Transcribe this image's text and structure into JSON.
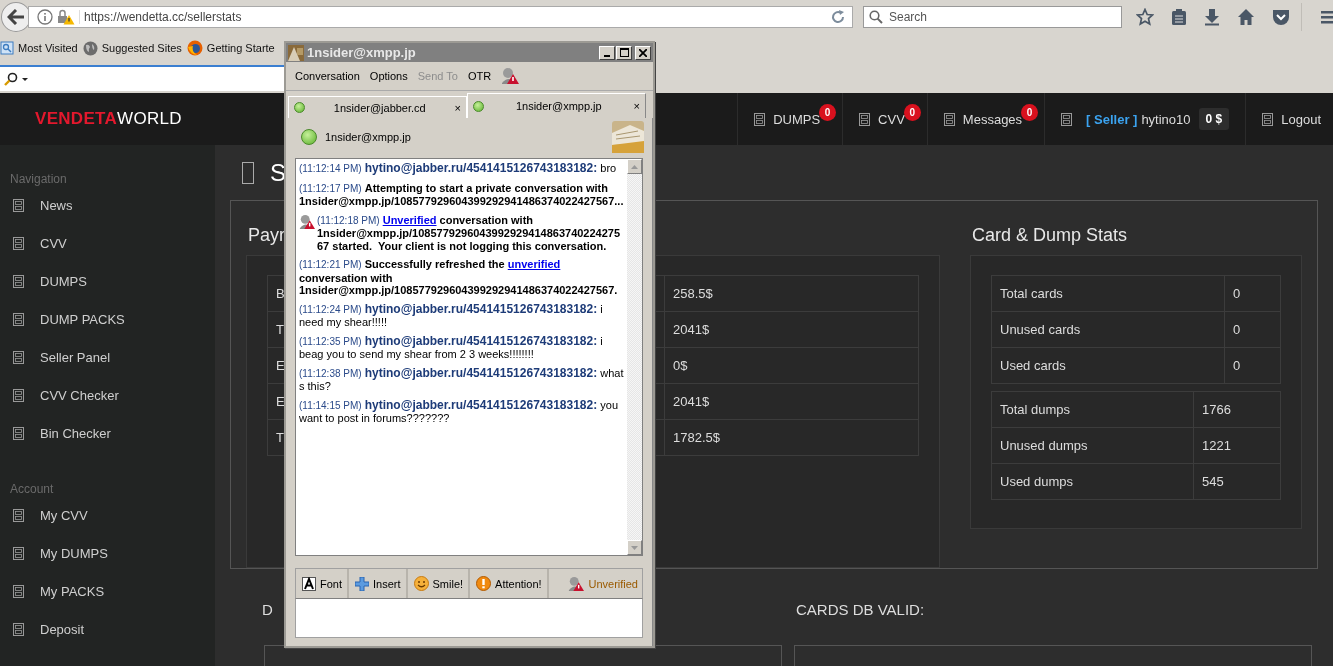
{
  "browser": {
    "url": "https://wendetta.cc/sellerstats",
    "search": {
      "placeholder": "Search"
    },
    "bookmarks": [
      {
        "label": "Most Visited",
        "kind": "folder"
      },
      {
        "label": "Suggested Sites",
        "kind": "globe"
      },
      {
        "label": "Getting Starte",
        "kind": "firefox"
      }
    ]
  },
  "site": {
    "logo": {
      "accent": "VENDETA",
      "text": "WORLD"
    },
    "nav": [
      {
        "label": "DUMPS",
        "badge": "0"
      },
      {
        "label": "CVV",
        "badge": "0"
      },
      {
        "label": "Messages",
        "badge": "0"
      }
    ],
    "user": {
      "role": "[ Seller ]",
      "name": "hytino10",
      "balance": "0 $"
    },
    "logout": "Logout"
  },
  "sidebar": {
    "sections": [
      {
        "heading": "Navigation",
        "items": [
          "News",
          "CVV",
          "DUMPS",
          "DUMP PACKS",
          "Seller Panel",
          "CVV Checker",
          "Bin Checker"
        ]
      },
      {
        "heading": "Account",
        "items": [
          "My CVV",
          "My DUMPS",
          "My PACKS",
          "Deposit"
        ]
      }
    ]
  },
  "page": {
    "title": "S",
    "payments": {
      "heading": "Payr",
      "rows": [
        {
          "label": "B",
          "value": "258.5$"
        },
        {
          "label": "T",
          "value": "2041$"
        },
        {
          "label": "E",
          "value": "0$"
        },
        {
          "label": "E",
          "value": "2041$"
        },
        {
          "label": "T",
          "value": "1782.5$"
        }
      ]
    },
    "stats": {
      "heading": "Card & Dump Stats",
      "groups": [
        [
          {
            "label": "Total cards",
            "value": "0"
          },
          {
            "label": "Unused cards",
            "value": "0"
          },
          {
            "label": "Used cards",
            "value": "0"
          }
        ],
        [
          {
            "label": "Total dumps",
            "value": "1766"
          },
          {
            "label": "Unused dumps",
            "value": "1221"
          },
          {
            "label": "Used dumps",
            "value": "545"
          }
        ]
      ]
    },
    "bottom": [
      "D",
      "CARDS DB VALID:"
    ]
  },
  "chat_window": {
    "title": "1nsider@xmpp.jp",
    "menu": [
      {
        "label": "Conversation",
        "disabled": false
      },
      {
        "label": "Options",
        "disabled": false
      },
      {
        "label": "Send To",
        "disabled": true
      },
      {
        "label": "OTR",
        "disabled": false
      }
    ],
    "tabs": [
      {
        "label": "1nsider@jabber.cd",
        "close": "×",
        "selected": false
      },
      {
        "label": "1nsider@xmpp.jp",
        "close": "×",
        "selected": true
      }
    ],
    "contact": "1nsider@xmpp.jp",
    "messages": [
      {
        "kind": "incoming",
        "time": "(11:12:14 PM)",
        "sender": "hytino@jabber.ru/4541415126743183182:",
        "text": "bro"
      },
      {
        "kind": "system",
        "warning": false,
        "time": "(11:12:17 PM)",
        "parts": [
          {
            "text": "Attempting to start a private conversation with 1nsider@xmpp.jp/108577929604399292941486374022427567...",
            "link": false
          }
        ]
      },
      {
        "kind": "system",
        "warning": true,
        "time": "(11:12:18 PM)",
        "parts": [
          {
            "text": "Unverified",
            "link": true
          },
          {
            "text": " conversation with 1nsider@xmpp.jp/108577929604399292941486374022427567 started.  Your client is not logging this conversation.",
            "link": false
          }
        ]
      },
      {
        "kind": "system",
        "warning": false,
        "time": "(11:12:21 PM)",
        "parts": [
          {
            "text": "Successfully refreshed the ",
            "link": false
          },
          {
            "text": "unverified",
            "link": true
          },
          {
            "text": " conversation with 1nsider@xmpp.jp/108577929604399292941486374022427567.",
            "link": false
          }
        ]
      },
      {
        "kind": "incoming",
        "time": "(11:12:24 PM)",
        "sender": "hytino@jabber.ru/4541415126743183182:",
        "text": "i need my shear!!!!!"
      },
      {
        "kind": "incoming",
        "time": "(11:12:35 PM)",
        "sender": "hytino@jabber.ru/4541415126743183182:",
        "text": "i beag you to send my shear from 2 3 weeks!!!!!!!!"
      },
      {
        "kind": "incoming",
        "time": "(11:12:38 PM)",
        "sender": "hytino@jabber.ru/4541415126743183182:",
        "text": "what s this?"
      },
      {
        "kind": "incoming",
        "time": "(11:14:15 PM)",
        "sender": "hytino@jabber.ru/4541415126743183182:",
        "text": "you want to post in forums???????"
      }
    ],
    "toolbar": [
      {
        "label": "Font",
        "kind": "font"
      },
      {
        "label": "Insert",
        "kind": "insert"
      },
      {
        "label": "Smile!",
        "kind": "smile"
      },
      {
        "label": "Attention!",
        "kind": "attention"
      },
      {
        "label": "Unverified",
        "kind": "otr"
      }
    ]
  }
}
